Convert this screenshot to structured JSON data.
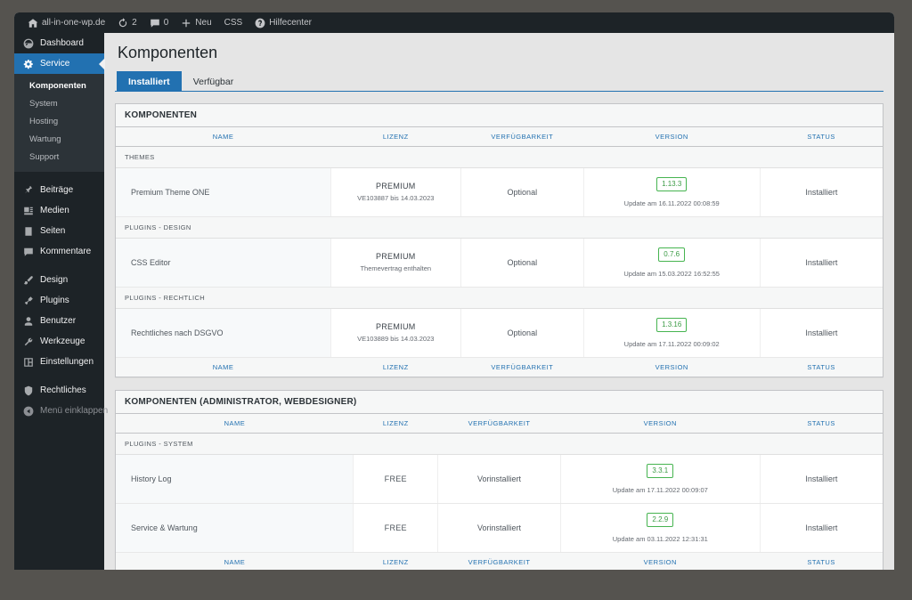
{
  "adminbar": {
    "site_icon": "home-icon",
    "site_name": "all-in-one-wp.de",
    "updates_icon": "updates-icon",
    "updates_count": "2",
    "comments_icon": "comment-icon",
    "comments_count": "0",
    "new_icon": "plus-icon",
    "new_label": "Neu",
    "css_label": "CSS",
    "help_icon": "help-icon",
    "help_label": "Hilfecenter"
  },
  "sidebar": {
    "items": [
      {
        "label": "Dashboard",
        "icon": "dashboard-icon",
        "current": false
      },
      {
        "label": "Service",
        "icon": "gear-icon",
        "current": true
      }
    ],
    "submenu": [
      {
        "label": "Komponenten",
        "current": true
      },
      {
        "label": "System",
        "current": false
      },
      {
        "label": "Hosting",
        "current": false
      },
      {
        "label": "Wartung",
        "current": false
      },
      {
        "label": "Support",
        "current": false
      }
    ],
    "group2": [
      {
        "label": "Beiträge",
        "icon": "pin-icon"
      },
      {
        "label": "Medien",
        "icon": "media-icon"
      },
      {
        "label": "Seiten",
        "icon": "page-icon"
      },
      {
        "label": "Kommentare",
        "icon": "comment-icon"
      }
    ],
    "group3": [
      {
        "label": "Design",
        "icon": "brush-icon"
      },
      {
        "label": "Plugins",
        "icon": "plugin-icon"
      },
      {
        "label": "Benutzer",
        "icon": "user-icon"
      },
      {
        "label": "Werkzeuge",
        "icon": "wrench-icon"
      },
      {
        "label": "Einstellungen",
        "icon": "sliders-icon"
      }
    ],
    "group4": [
      {
        "label": "Rechtliches",
        "icon": "shield-icon"
      }
    ],
    "collapse": {
      "label": "Menü einklappen",
      "icon": "collapse-icon"
    }
  },
  "page": {
    "title": "Komponenten",
    "tabs": [
      {
        "label": "Installiert",
        "active": true
      },
      {
        "label": "Verfügbar",
        "active": false
      }
    ]
  },
  "columns": [
    "NAME",
    "LIZENZ",
    "VERFÜGBARKEIT",
    "VERSION",
    "STATUS"
  ],
  "tables": [
    {
      "heading": "KOMPONENTEN",
      "col_widths": [
        "28%",
        "17%",
        "16%",
        "23%",
        "16%"
      ],
      "groups": [
        {
          "section": "THEMES",
          "rows": [
            {
              "name": "Premium Theme ONE",
              "license": "PREMIUM",
              "license_sub": "VE103887 bis 14.03.2023",
              "availability": "Optional",
              "version": "1.13.3",
              "version_sub": "Update am 16.11.2022 00:08:59",
              "status": "Installiert"
            }
          ]
        },
        {
          "section": "PLUGINS - DESIGN",
          "rows": [
            {
              "name": "CSS Editor",
              "license": "PREMIUM",
              "license_sub": "Themevertrag enthalten",
              "availability": "Optional",
              "version": "0.7.6",
              "version_sub": "Update am 15.03.2022 16:52:55",
              "status": "Installiert"
            }
          ]
        },
        {
          "section": "PLUGINS - RECHTLICH",
          "rows": [
            {
              "name": "Rechtliches nach DSGVO",
              "license": "PREMIUM",
              "license_sub": "VE103889 bis 14.03.2023",
              "availability": "Optional",
              "version": "1.3.16",
              "version_sub": "Update am 17.11.2022 00:09:02",
              "status": "Installiert"
            }
          ]
        }
      ]
    },
    {
      "heading": "KOMPONENTEN (ADMINISTRATOR, WEBDESIGNER)",
      "col_widths": [
        "31%",
        "11%",
        "16%",
        "26%",
        "16%"
      ],
      "groups": [
        {
          "section": "PLUGINS - SYSTEM",
          "rows": [
            {
              "name": "History Log",
              "license": "FREE",
              "license_sub": "",
              "availability": "Vorinstalliert",
              "version": "3.3.1",
              "version_sub": "Update am 17.11.2022 00:09:07",
              "status": "Installiert"
            },
            {
              "name": "Service & Wartung",
              "license": "FREE",
              "license_sub": "",
              "availability": "Vorinstalliert",
              "version": "2.2.9",
              "version_sub": "Update am 03.11.2022 12:31:31",
              "status": "Installiert"
            }
          ]
        }
      ]
    }
  ],
  "colors": {
    "accent": "#2271b1",
    "admin_bg": "#1d2327",
    "submenu_bg": "#2c3338",
    "badge_green": "#46b450",
    "page_bg": "#e5e5e5",
    "desktop_bg": "#55534f"
  }
}
